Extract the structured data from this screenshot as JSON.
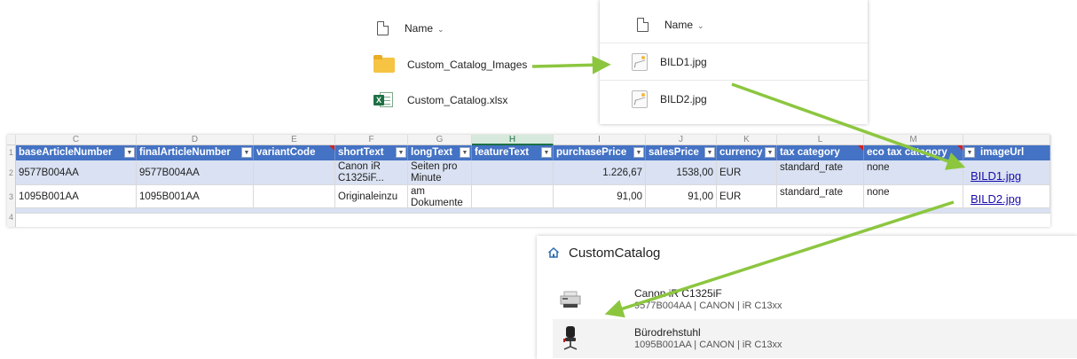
{
  "explorer_folder": {
    "header": "Name",
    "items": [
      {
        "name": "Custom_Catalog_Images",
        "icon": "folder-icon"
      },
      {
        "name": "Custom_Catalog.xlsx",
        "icon": "excel-file-icon"
      }
    ]
  },
  "explorer_images": {
    "header": "Name",
    "items": [
      {
        "name": "BILD1.jpg",
        "icon": "image-file-icon"
      },
      {
        "name": "BILD2.jpg",
        "icon": "image-file-icon"
      }
    ]
  },
  "spreadsheet": {
    "column_letters": [
      "C",
      "D",
      "E",
      "F",
      "G",
      "H",
      "I",
      "J",
      "K",
      "L",
      "M"
    ],
    "row_numbers": [
      "1",
      "2",
      "3",
      "4"
    ],
    "headers": [
      "baseArticleNumber",
      "finalArticleNumber",
      "variantCode",
      "shortText",
      "longText",
      "featureText",
      "purchasePrice",
      "salesPrice",
      "currency",
      "tax category",
      "eco tax category",
      "imageUrl"
    ],
    "rows": [
      {
        "baseArticleNumber": "9577B004AA",
        "finalArticleNumber": "9577B004AA",
        "variantCode": "",
        "shortText": "Canon iR C1325iF...",
        "longText": "Seiten pro Minute",
        "featureText": "",
        "purchasePrice": "1.226,67",
        "salesPrice": "1538,00",
        "currency": "EUR",
        "tax_category": "standard_rate",
        "eco_tax_category": "none",
        "imageUrl": "BILD1.jpg"
      },
      {
        "baseArticleNumber": "1095B001AA",
        "finalArticleNumber": "1095B001AA",
        "variantCode": "",
        "shortText": "Originaleinzu",
        "longText": "am Dokumente",
        "featureText": "",
        "purchasePrice": "91,00",
        "salesPrice": "91,00",
        "currency": "EUR",
        "tax_category": "standard_rate",
        "eco_tax_category": "none",
        "imageUrl": "BILD2.jpg"
      }
    ]
  },
  "catalog": {
    "title": "CustomCatalog",
    "items": [
      {
        "name": "Canon iR C1325iF",
        "sub": "9577B004AA | CANON | iR C13xx",
        "icon": "printer-icon"
      },
      {
        "name": "Bürodrehstuhl",
        "sub": "1095B001AA | CANON | iR C13xx",
        "icon": "office-chair-icon"
      }
    ]
  },
  "colors": {
    "header_blue": "#4472c4",
    "row_band": "#d9e1f2",
    "arrow_green": "#8cc63f",
    "link": "#1a0dab",
    "excel_green": "#1d7044",
    "folder_yellow": "#f6c343"
  }
}
